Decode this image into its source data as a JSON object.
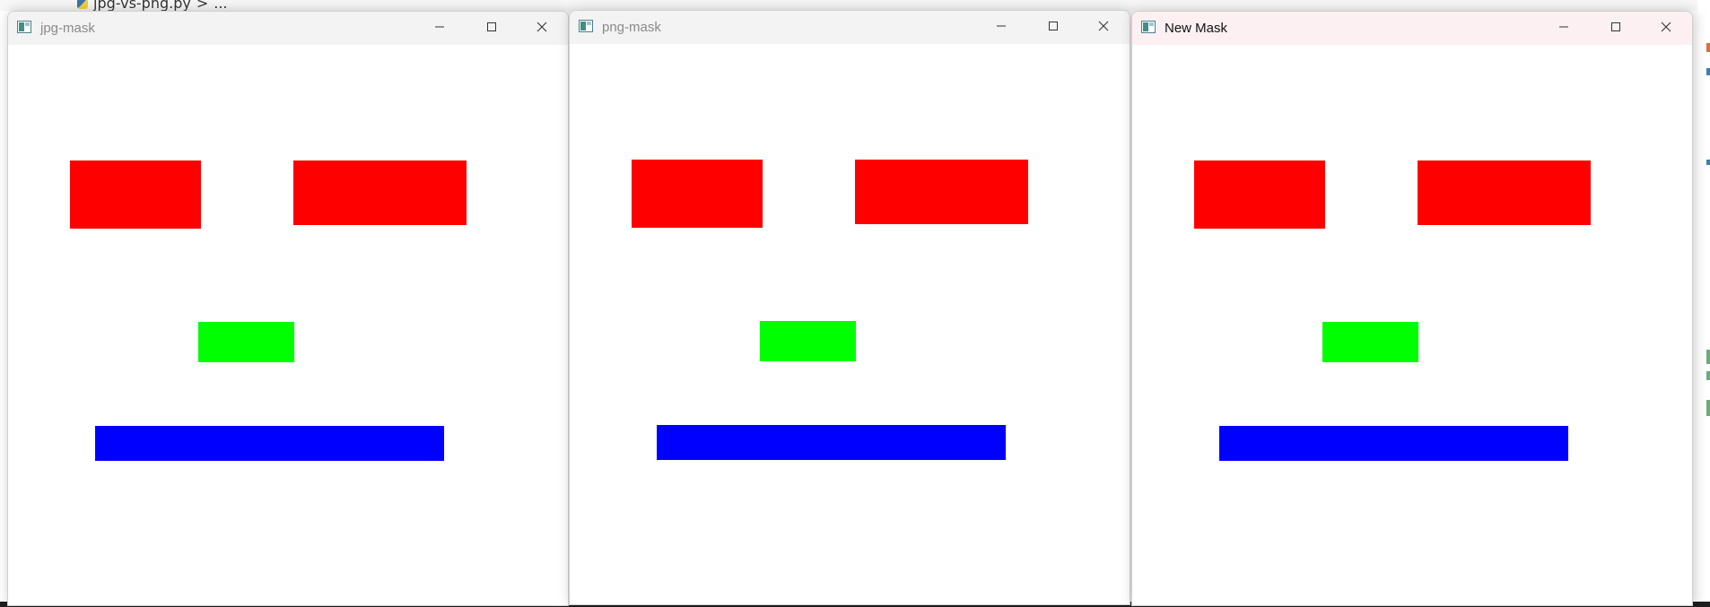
{
  "editor": {
    "breadcrumb_file": "jpg-vs-png.py",
    "breadcrumb_sep": ">",
    "breadcrumb_more": "..."
  },
  "windows": [
    {
      "title": "jpg-mask",
      "active": false,
      "controls": {
        "minimize": "minimize",
        "maximize": "maximize",
        "close": "close"
      }
    },
    {
      "title": "png-mask",
      "active": false,
      "controls": {
        "minimize": "minimize",
        "maximize": "maximize",
        "close": "close"
      }
    },
    {
      "title": "New Mask",
      "active": true,
      "controls": {
        "minimize": "minimize",
        "maximize": "maximize",
        "close": "close"
      }
    }
  ],
  "colors": {
    "red": "#ff0000",
    "green": "#00ff00",
    "blue": "#0000ff",
    "canvas": "#ffffff"
  },
  "icons": {
    "app": "image-app-icon",
    "minimize": "minimize-icon",
    "maximize": "maximize-icon",
    "close": "close-icon"
  }
}
